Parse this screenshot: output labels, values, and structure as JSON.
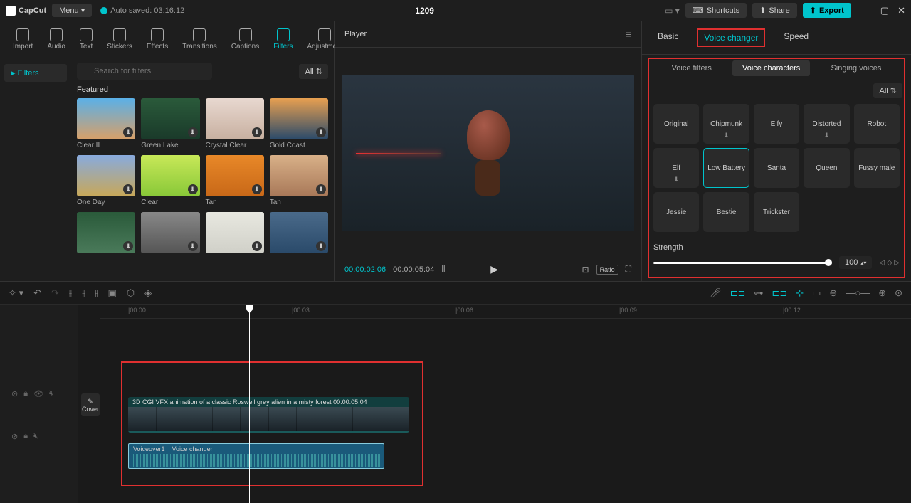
{
  "app": {
    "name": "CapCut",
    "menu": "Menu",
    "autosaved": "Auto saved: 03:16:12",
    "project": "1209"
  },
  "topButtons": {
    "shortcuts": "Shortcuts",
    "share": "Share",
    "export": "Export"
  },
  "toolTabs": [
    "Import",
    "Audio",
    "Text",
    "Stickers",
    "Effects",
    "Transitions",
    "Captions",
    "Filters",
    "Adjustment"
  ],
  "activeToolTab": "Filters",
  "filtersNav": "Filters",
  "search": {
    "placeholder": "Search for filters",
    "all": "All"
  },
  "featuredLabel": "Featured",
  "filters": [
    {
      "name": "Clear II",
      "bg": "linear-gradient(180deg,#5ab0e8,#d8a068)"
    },
    {
      "name": "Green Lake",
      "bg": "linear-gradient(180deg,#2a5a3a,#1a3a2a)"
    },
    {
      "name": "Crystal Clear",
      "bg": "linear-gradient(180deg,#e8d8d0,#c8b0a0)"
    },
    {
      "name": "Gold Coast",
      "bg": "linear-gradient(180deg,#e8a050,#2a4a6a)"
    },
    {
      "name": "One Day",
      "bg": "linear-gradient(180deg,#88aadd,#c8a858)"
    },
    {
      "name": "Clear",
      "bg": "linear-gradient(180deg,#c8e858,#88c838)"
    },
    {
      "name": "Tan",
      "bg": "linear-gradient(180deg,#e88828,#c86818)"
    },
    {
      "name": "Tan",
      "bg": "linear-gradient(180deg,#d8b088,#a87858)"
    },
    {
      "name": "",
      "bg": "linear-gradient(180deg,#2a5a3a,#4a7a5a)"
    },
    {
      "name": "",
      "bg": "linear-gradient(180deg,#888,#555)"
    },
    {
      "name": "",
      "bg": "linear-gradient(180deg,#e8e8e0,#d0d0c8)"
    },
    {
      "name": "",
      "bg": "linear-gradient(180deg,#4a6a8a,#2a4a6a)"
    }
  ],
  "player": {
    "title": "Player",
    "currentTime": "00:00:02:06",
    "totalTime": "00:00:05:04",
    "ratio": "Ratio"
  },
  "rightTabs": [
    "Basic",
    "Voice changer",
    "Speed"
  ],
  "activeRightTab": "Voice changer",
  "subTabs": [
    "Voice filters",
    "Voice characters",
    "Singing voices"
  ],
  "activeSubTab": "Voice characters",
  "allLabel": "All",
  "voices": [
    {
      "name": "Original"
    },
    {
      "name": "Chipmunk",
      "dl": true
    },
    {
      "name": "Elfy"
    },
    {
      "name": "Distorted",
      "dl": true
    },
    {
      "name": "Robot"
    },
    {
      "name": "Elf",
      "dl": true
    },
    {
      "name": "Low Battery",
      "selected": true
    },
    {
      "name": "Santa"
    },
    {
      "name": "Queen"
    },
    {
      "name": "Fussy male"
    },
    {
      "name": "Jessie"
    },
    {
      "name": "Bestie"
    },
    {
      "name": "Trickster"
    }
  ],
  "strength": {
    "label": "Strength",
    "value": "100"
  },
  "ruler": [
    "|00:00",
    "|00:03",
    "|00:06",
    "|00:09",
    "|00:12"
  ],
  "clip": {
    "title": "3D CGI VFX animation of a classic Roswell grey alien in a misty forest  00:00:05:04"
  },
  "audio": {
    "label1": "Voiceover1",
    "label2": "Voice changer"
  },
  "coverLabel": "Cover"
}
